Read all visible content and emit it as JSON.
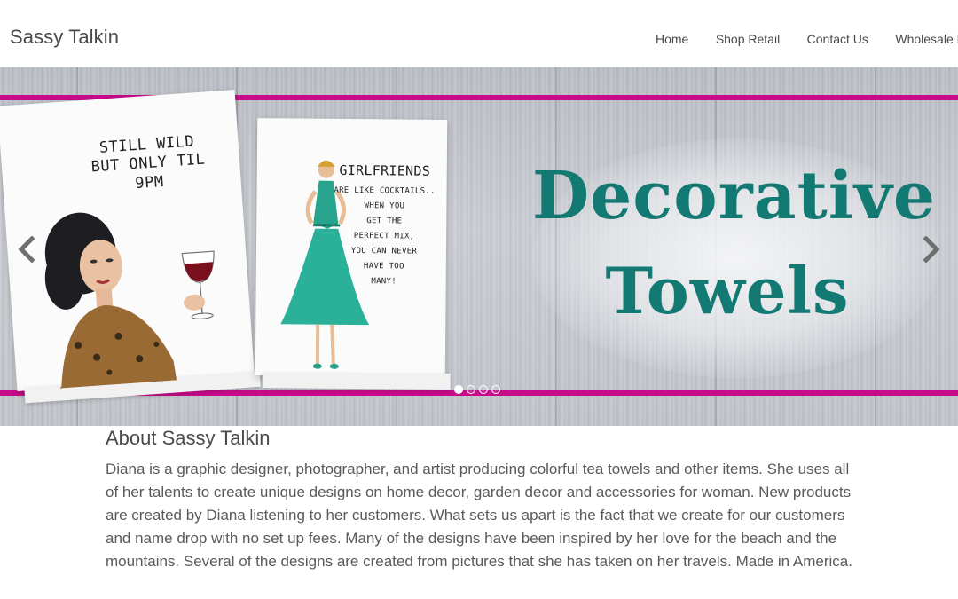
{
  "header": {
    "brand": "Sassy Talkin",
    "nav": [
      "Home",
      "Shop Retail",
      "Contact Us",
      "Wholesale Log"
    ]
  },
  "slider": {
    "headline_line1": "Decorative",
    "headline_line2": "Towels",
    "towel1_text": "STILL WILD\nBUT ONLY TIL\n9PM",
    "towel2_title": "GIRLFRIENDS",
    "towel2_text": "ARE LIKE COCKTAILS..\nWHEN YOU\nGET THE\nPERFECT MIX,\nYOU CAN NEVER\nHAVE TOO\nMANY!",
    "slides_total": 4,
    "active_slide": 1,
    "colors": {
      "stripe": "#c80b8a",
      "headline": "#127a73"
    },
    "icons": [
      "chevron-left-icon",
      "chevron-right-icon"
    ]
  },
  "about": {
    "title": "About Sassy Talkin",
    "body": "Diana is a graphic designer, photographer, and artist producing colorful tea towels and other items. She uses all of her talents to create unique designs on home decor, garden decor and accessories for woman. New products are created by Diana listening to her customers. What sets us apart is the fact that we create for our customers and name drop with no set up fees. Many of the designs have been inspired by her love for the beach and the mountains. Several of the designs are created from pictures that she has taken on her travels. Made in America."
  }
}
